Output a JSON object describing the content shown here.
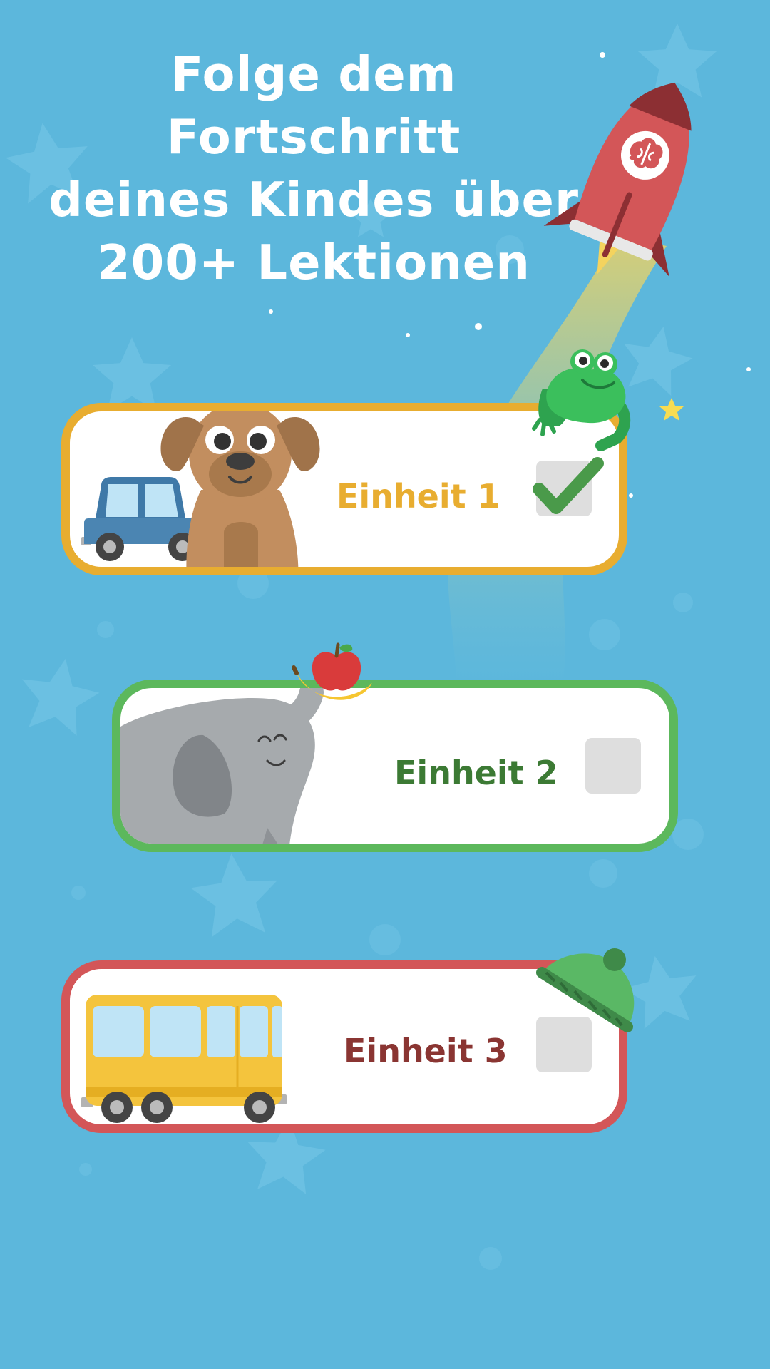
{
  "headline": {
    "lines": [
      "Folge dem Fortschritt",
      "deines Kindes über",
      "200+ Lektionen"
    ]
  },
  "colors": {
    "background": "#5cb7dc",
    "headline_text": "#ffffff",
    "unit1_accent": "#e8ad30",
    "unit2_accent": "#5cb85c",
    "unit2_text": "#3c7a34",
    "unit3_accent": "#d35658",
    "unit3_text": "#8a3532",
    "checkbox_fill": "#dedede",
    "checkmark": "#4a9a4a"
  },
  "units": [
    {
      "label": "Einheit 1",
      "completed": true,
      "icons": [
        "dog-icon",
        "car-icon",
        "frog-icon",
        "checkmark-icon"
      ]
    },
    {
      "label": "Einheit 2",
      "completed": false,
      "icons": [
        "elephant-icon",
        "apple-icon",
        "banana-icon"
      ]
    },
    {
      "label": "Einheit 3",
      "completed": false,
      "icons": [
        "bus-icon",
        "hat-icon"
      ]
    }
  ],
  "decorations": [
    "rocket-icon",
    "brain-logo-icon",
    "star-icon"
  ]
}
